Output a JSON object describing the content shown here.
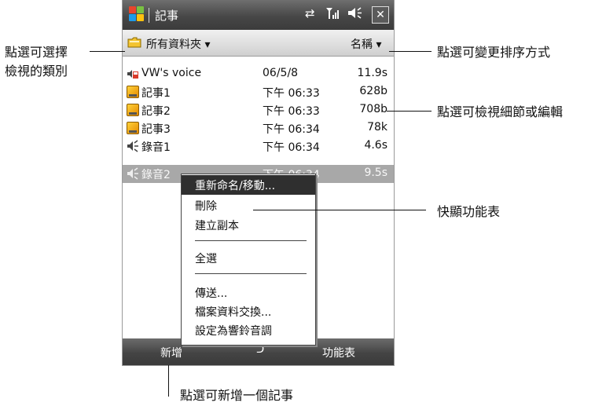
{
  "titlebar": {
    "app_title": "記事",
    "sync_icon": "sync-arrows-icon",
    "signal_icon": "signal-icon",
    "volume_icon": "speaker-icon",
    "close_label": "✕"
  },
  "toolbar": {
    "folder_label": "所有資料夾 ▾",
    "sort_label": "名稱 ▾"
  },
  "files": [
    {
      "name": "VW's voice",
      "date": "06/5/8",
      "size": "11.9s",
      "type": "voice"
    },
    {
      "name": "記事1",
      "date": "下午 06:33",
      "size": "628b",
      "type": "note"
    },
    {
      "name": "記事2",
      "date": "下午 06:33",
      "size": "708b",
      "type": "note"
    },
    {
      "name": "記事3",
      "date": "下午 06:34",
      "size": "78k",
      "type": "note"
    },
    {
      "name": "錄音1",
      "date": "下午 06:34",
      "size": "4.6s",
      "type": "voice"
    },
    {
      "name": "錄音2",
      "date": "下午 06:34",
      "size": "9.5s",
      "type": "voice"
    }
  ],
  "context_menu": {
    "items": [
      "重新命名/移動...",
      "刪除",
      "建立副本",
      "全選",
      "傳送...",
      "檔案資料交換...",
      "設定為響鈴音調"
    ]
  },
  "bottombar": {
    "new_label": "新增",
    "mid_label": "ᑐ",
    "menu_label": "功能表"
  },
  "callouts": {
    "category_line1": "點選可選擇",
    "category_line2": "檢視的類別",
    "sort": "點選可變更排序方式",
    "details": "點選可檢視細節或編輯",
    "popup": "快顯功能表",
    "new": "點選可新增一個記事"
  },
  "colors": {
    "titlebar": "#474747",
    "selected_row": "#a8a8a8",
    "menu_highlight": "#2f2f2f"
  }
}
